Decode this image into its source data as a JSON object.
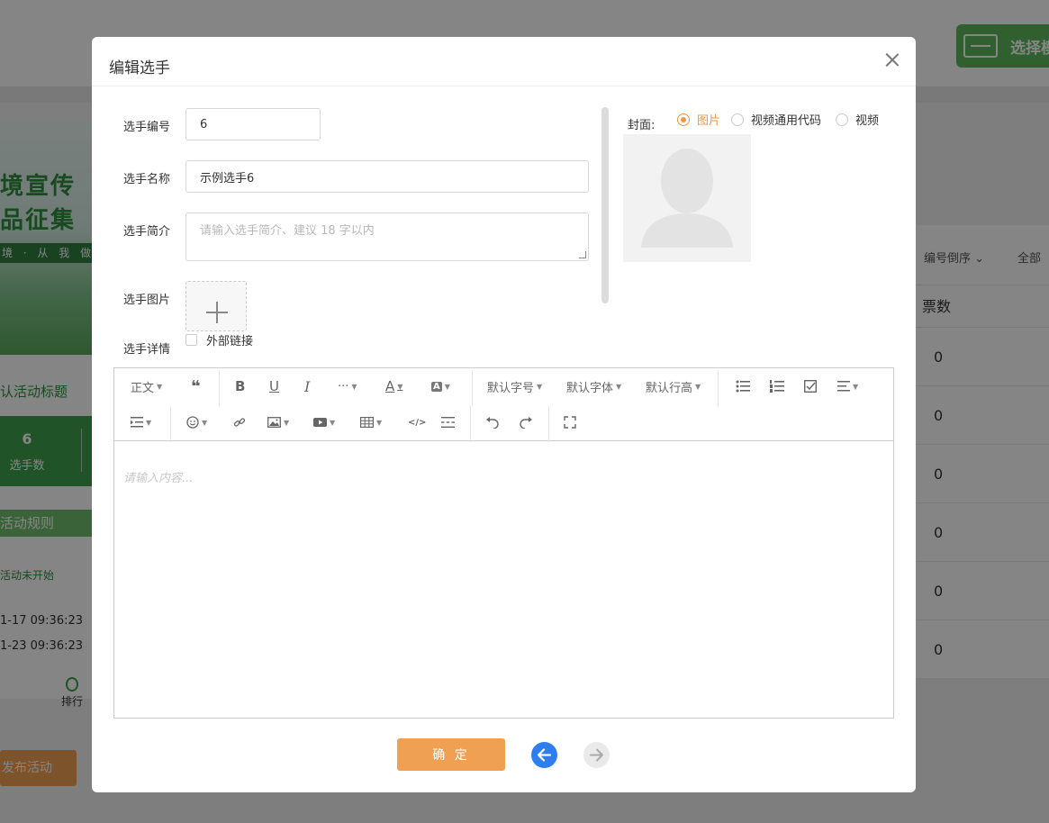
{
  "background": {
    "choose_button": "选择模",
    "banner": {
      "line1": "境宣传",
      "line2": "品征集",
      "line3": "境 · 从 我 做"
    },
    "activity_title": "认活动标题",
    "stat": {
      "value": "6",
      "label": "选手数"
    },
    "rules_label": "活动规则",
    "status_label": "活动未开始",
    "time_start": "1-17 09:36:23",
    "time_end": "1-23 09:36:23",
    "rank_label": "排行",
    "publish_button": "发布活动",
    "sort_label": "编号倒序",
    "filter_label": "全部",
    "votes_header": "票数",
    "vote_rows": [
      "0",
      "0",
      "0",
      "0",
      "0",
      "0"
    ]
  },
  "modal": {
    "title": "编辑选手",
    "fields": {
      "number_label": "选手编号",
      "number_value": "6",
      "name_label": "选手名称",
      "name_value": "示例选手6",
      "brief_label": "选手简介",
      "brief_placeholder": "请输入选手简介、建议 18 字以内",
      "image_label": "选手图片",
      "detail_label": "选手详情",
      "external_link_label": "外部链接"
    },
    "cover": {
      "label": "封面:",
      "options": [
        {
          "label": "图片",
          "selected": true
        },
        {
          "label": "视频通用代码",
          "selected": false
        },
        {
          "label": "视频",
          "selected": false
        }
      ]
    },
    "editor": {
      "toolbar": {
        "paragraph": "正文",
        "font_size": "默认字号",
        "font_family": "默认字体",
        "line_height": "默认行高",
        "bold": "B",
        "underline": "U",
        "italic": "I",
        "more": "···",
        "font_color": "A",
        "bg_color": "A"
      },
      "placeholder": "请输入内容..."
    },
    "confirm_button": "确 定"
  },
  "colors": {
    "accent_orange": "#f0a053",
    "radio_orange": "#f0963f",
    "nav_blue": "#2f7ef0",
    "brand_green": "#3ea24e"
  }
}
